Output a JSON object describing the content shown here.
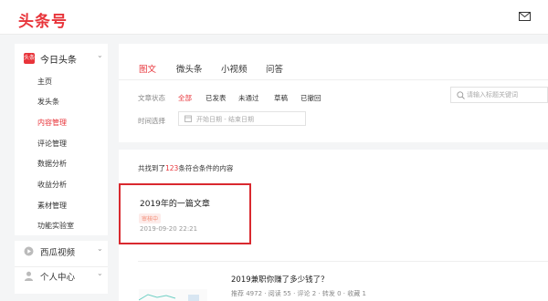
{
  "header": {
    "logo": "头条号"
  },
  "sidebar": {
    "section": {
      "badge": "头条",
      "label": "今日头条",
      "chevron": "⌄"
    },
    "items": [
      {
        "label": "主页"
      },
      {
        "label": "发头条"
      },
      {
        "label": "内容管理",
        "active": true
      },
      {
        "label": "评论管理"
      },
      {
        "label": "数据分析"
      },
      {
        "label": "收益分析"
      },
      {
        "label": "素材管理"
      },
      {
        "label": "功能实验室"
      }
    ],
    "extra": [
      {
        "label": "西瓜视频",
        "icon": "xigua-icon",
        "chevron": "⌄"
      },
      {
        "label": "个人中心",
        "icon": "user-icon",
        "chevron": "⌄"
      }
    ]
  },
  "tabs": [
    {
      "label": "图文",
      "active": true
    },
    {
      "label": "微头条"
    },
    {
      "label": "小视频"
    },
    {
      "label": "问答"
    }
  ],
  "filters": {
    "status_label": "文章状态",
    "status_options": [
      {
        "label": "全部",
        "active": true
      },
      {
        "label": "已发表"
      },
      {
        "label": "未通过"
      },
      {
        "label": "草稿"
      },
      {
        "label": "已撤回"
      }
    ],
    "time_label": "时间选择",
    "date_placeholder": "开始日期 - 结束日期",
    "search_placeholder": "请输入标题关键词"
  },
  "results": {
    "prefix": "共找到了",
    "count": "123",
    "suffix": "条符合条件的内容"
  },
  "articles": [
    {
      "title": "2019年的一篇文章",
      "status": "审核中",
      "date": "2019-09-20 22:21"
    },
    {
      "title": "2019兼职你赚了多少钱了？",
      "stats": "推荐 4972 · 阅读 55 · 评论 2 · 转发 0 · 收藏 1"
    }
  ],
  "colors": {
    "accent": "#e8343a",
    "highlight_border": "#d9292f"
  }
}
